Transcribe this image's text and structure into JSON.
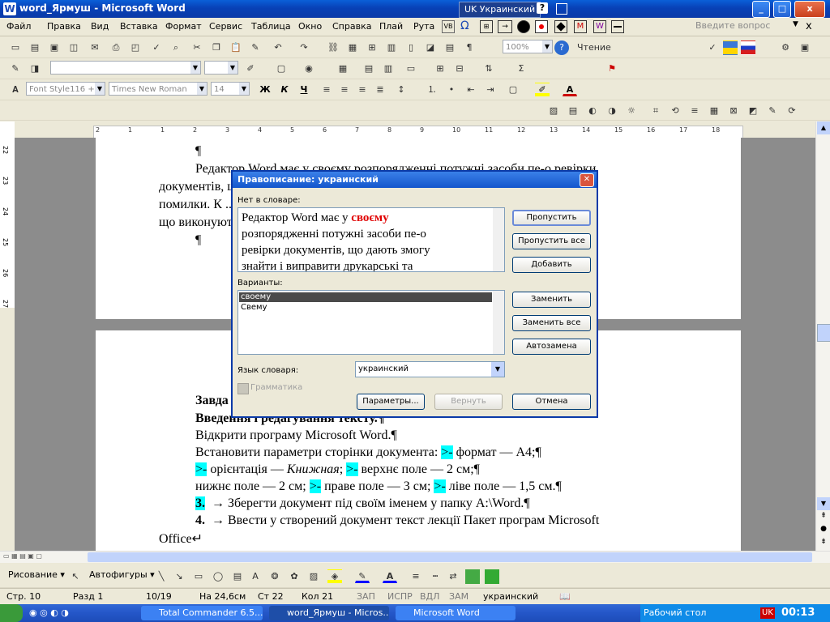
{
  "window": {
    "title": "word_Ярмуш - Microsoft Word",
    "app_icon": "W",
    "language_indicator": "UK Украинский",
    "help_question": "?",
    "controls": [
      "_",
      "□",
      "x"
    ]
  },
  "menu": {
    "items": [
      "Файл",
      "Правка",
      "Вид",
      "Вставка",
      "Формат",
      "Сервис",
      "Таблица",
      "Окно",
      "Справка",
      "Плай",
      "Рута"
    ],
    "help_placeholder": "Введите вопрос",
    "close": "x"
  },
  "toolbar_standard": {
    "zoom": "100%",
    "reading_button": "Чтение"
  },
  "toolbar_formatting": {
    "style": "Font Style116 +",
    "font": "Times New Roman",
    "size": "14",
    "bold": "Ж",
    "italic": "К",
    "underline": "Ч"
  },
  "ruler": {
    "numbers": [
      "2",
      "1",
      "1",
      "2",
      "3",
      "4",
      "5",
      "6",
      "7",
      "8",
      "9",
      "10",
      "11",
      "12",
      "13",
      "14",
      "15",
      "16",
      "17",
      "18"
    ],
    "vertical_numbers": [
      "22",
      "23",
      "24",
      "25",
      "26",
      "27"
    ]
  },
  "document": {
    "page1": [
      "¶",
      "Редактор Word має у своєму розпорядженні потужні засоби пе-о ревірки",
      "документів, що дають змогу знайти і виправити друкарські та орфографічні",
      "помилки. К ... програмами,",
      "що виконуються",
      "¶"
    ],
    "page2": {
      "heading1": "Завда",
      "heading2": "Введення і редагування тексту.¶",
      "line1": "Відкрити програму Microsoft Word.¶",
      "line2_a": "Встановити параметри сторінки документа: ",
      "line2_b": "формат — А4;¶",
      "line3_a": "орієнтація — ",
      "line3_italic": "Книжная",
      "line3_b": "верхнє поле — 2 см;¶",
      "line4_a": "нижнє поле — 2 см; ",
      "line4_b": "праве поле — 3 см; ",
      "line4_c": "ліве поле — 1,5 см.¶",
      "arrow_marker": ">-",
      "item3_num": "3.",
      "item3_text": "→ Зберегти документ під своїм іменем у папку A:\\Word.¶",
      "item4_num": "4.",
      "item4_text": "→ Ввести у створений документ текст лекції Пакет програм Microsoft",
      "item4_cont": "Office↵"
    }
  },
  "dialog": {
    "title": "Правописание: украинский",
    "not_in_dict_label": "Нет в словаре:",
    "sentence_before": "Редактор Word має у ",
    "misspelled": "своєму",
    "sentence_lines": [
      "розпорядженні потужні засоби пе-о",
      "ревірки документів, що дають змогу",
      "знайти і виправити друкарські та"
    ],
    "variants_label": "Варианты:",
    "variants": [
      "своему",
      "Свему"
    ],
    "language_label": "Язык словаря:",
    "language_value": "украинский",
    "grammar_label": "Грамматика",
    "buttons": {
      "skip": "Пропустить",
      "skip_all": "Пропустить все",
      "add": "Добавить",
      "replace": "Заменить",
      "replace_all": "Заменить все",
      "autocorrect": "Автозамена",
      "options": "Параметры...",
      "undo": "Вернуть",
      "cancel": "Отмена"
    }
  },
  "drawing_toolbar": {
    "drawing": "Рисование",
    "autoshapes": "Автофигуры"
  },
  "status": {
    "page": "Стр. 10",
    "section": "Разд 1",
    "pages": "10/19",
    "at": "На 24,6см",
    "line": "Ст 22",
    "col": "Кол 21",
    "rec": "ЗАП",
    "trk": "ИСПР",
    "ext": "ВДЛ",
    "ovr": "ЗАМ",
    "lang": "украинский"
  },
  "taskbar": {
    "tasks": [
      "Total Commander 6.5...",
      "word_Ярмуш - Micros...",
      "Microsoft Word"
    ],
    "desktop": "Рабочий стол",
    "lang": "UK",
    "time": "00:13"
  }
}
